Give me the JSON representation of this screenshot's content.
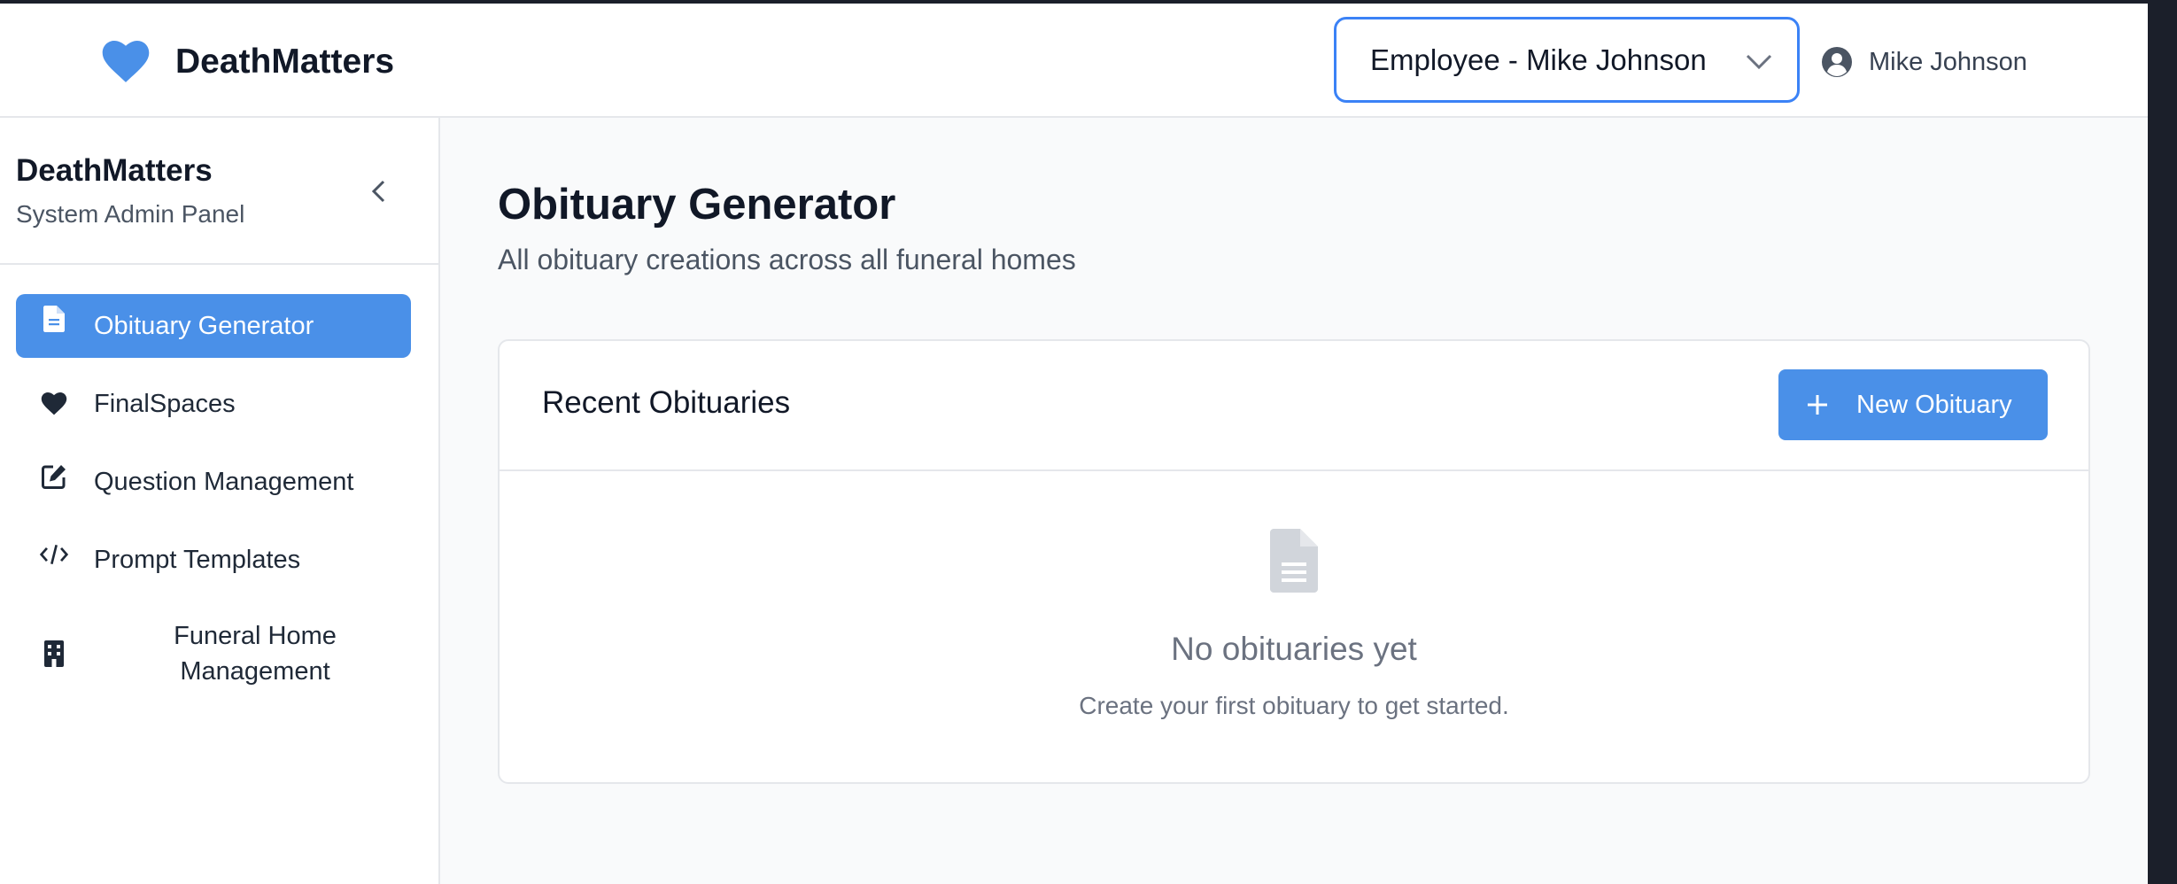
{
  "topbar": {
    "brand": "DeathMatters",
    "brand_icon": "heart-icon",
    "role_select": {
      "value": "Employee - Mike Johnson"
    },
    "user": {
      "name": "Mike Johnson",
      "icon": "user-circle-icon"
    }
  },
  "sidebar": {
    "title": "DeathMatters",
    "subtitle": "System Admin Panel",
    "items": [
      {
        "label": "Obituary Generator",
        "icon": "document-icon",
        "active": true
      },
      {
        "label": "FinalSpaces",
        "icon": "heart-icon",
        "active": false
      },
      {
        "label": "Question Management",
        "icon": "edit-icon",
        "active": false
      },
      {
        "label": "Prompt Templates",
        "icon": "code-icon",
        "active": false
      },
      {
        "label": "Funeral Home Management",
        "icon": "building-icon",
        "active": false
      }
    ]
  },
  "main": {
    "title": "Obituary Generator",
    "subtitle": "All obituary creations across all funeral homes",
    "card": {
      "title": "Recent Obituaries",
      "new_button": "New Obituary",
      "empty_title": "No obituaries yet",
      "empty_sub": "Create your first obituary to get started."
    }
  },
  "colors": {
    "accent": "#4a90e8",
    "focus_border": "#3b82f6",
    "text_primary": "#111827",
    "text_muted": "#6b7280"
  }
}
